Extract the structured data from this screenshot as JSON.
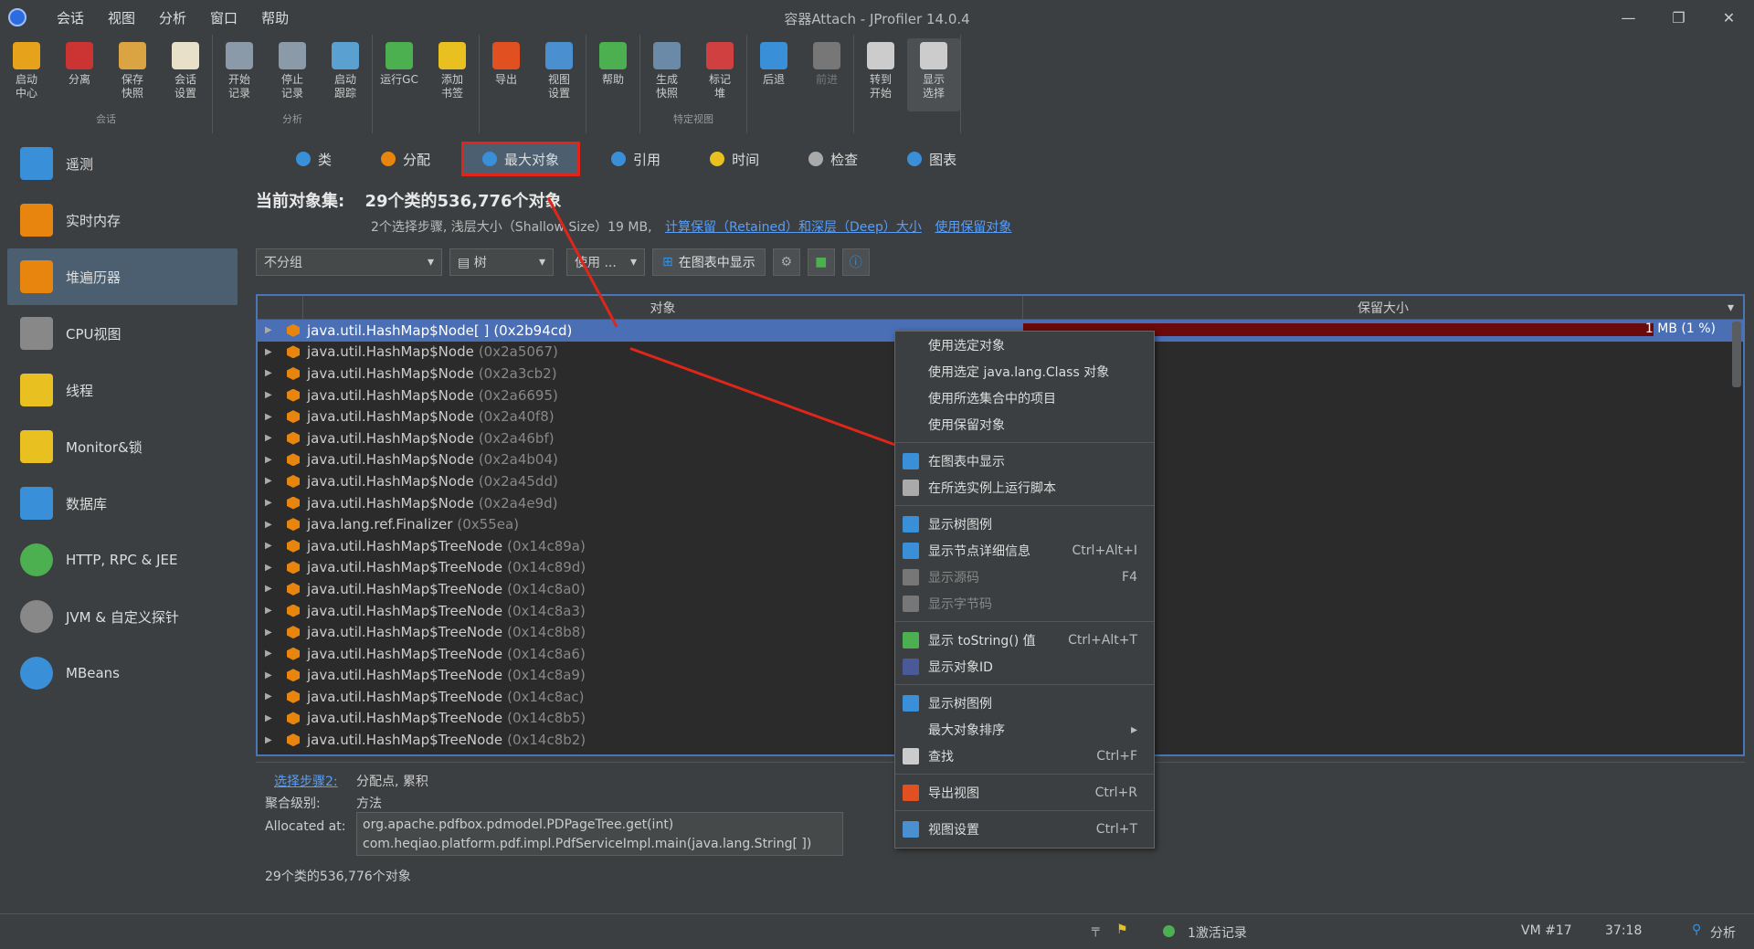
{
  "window": {
    "title": "容器Attach - JProfiler 14.0.4"
  },
  "menu": [
    "会话",
    "视图",
    "分析",
    "窗口",
    "帮助"
  ],
  "toolbar": {
    "groups": [
      {
        "label": "会话",
        "buttons": [
          {
            "label": "启动\n中心",
            "icon": "start-center-icon",
            "color": "#e6a21a"
          },
          {
            "label": "分离",
            "icon": "detach-icon",
            "color": "#cc3333"
          },
          {
            "label": "保存\n快照",
            "icon": "save-snapshot-icon",
            "color": "#d9a441"
          },
          {
            "label": "会话\n设置",
            "icon": "session-settings-icon",
            "color": "#e8e0c8"
          }
        ]
      },
      {
        "label": "分析",
        "buttons": [
          {
            "label": "开始\n记录",
            "icon": "start-recording-icon",
            "color": "#8a9aa8"
          },
          {
            "label": "停止\n记录",
            "icon": "stop-recording-icon",
            "color": "#8a9aa8"
          },
          {
            "label": "启动\n跟踪",
            "icon": "start-tracking-icon",
            "color": "#5aa0d0"
          }
        ]
      },
      {
        "label": "",
        "buttons": [
          {
            "label": "运行GC",
            "icon": "run-gc-icon",
            "color": "#4caf50"
          },
          {
            "label": "添加\n书签",
            "icon": "add-bookmark-icon",
            "color": "#e8c020"
          }
        ]
      },
      {
        "label": "",
        "buttons": [
          {
            "label": "导出",
            "icon": "export-icon",
            "color": "#e05020"
          },
          {
            "label": "视图\n设置",
            "icon": "view-settings-icon",
            "color": "#4a90d0"
          }
        ]
      },
      {
        "label": "",
        "buttons": [
          {
            "label": "帮助",
            "icon": "help-icon",
            "color": "#4caf50"
          }
        ]
      },
      {
        "label": "特定视图",
        "buttons": [
          {
            "label": "生成\n快照",
            "icon": "heap-snapshot-icon",
            "color": "#6a8aa8"
          },
          {
            "label": "标记\n堆",
            "icon": "mark-heap-icon",
            "color": "#d04040"
          }
        ]
      },
      {
        "label": "",
        "buttons": [
          {
            "label": "后退",
            "icon": "back-icon",
            "color": "#3a8fd9"
          },
          {
            "label": "前进",
            "icon": "forward-icon",
            "color": "#777777"
          }
        ]
      },
      {
        "label": "",
        "buttons": [
          {
            "label": "转到\n开始",
            "icon": "go-to-start-icon",
            "color": "#cccccc"
          },
          {
            "label": "显示\n选择",
            "icon": "show-selection-icon",
            "color": "#cccccc"
          }
        ]
      }
    ]
  },
  "sidebar": {
    "items": [
      {
        "label": "遥测",
        "icon": "telemetry-icon",
        "color": "#3a8fd9"
      },
      {
        "label": "实时内存",
        "icon": "live-memory-icon",
        "color": "#e8850f"
      },
      {
        "label": "堆遍历器",
        "icon": "heap-walker-icon",
        "color": "#e8850f"
      },
      {
        "label": "CPU视图",
        "icon": "cpu-views-icon",
        "color": "#888888"
      },
      {
        "label": "线程",
        "icon": "threads-icon",
        "color": "#e8c020"
      },
      {
        "label": "Monitor&锁",
        "icon": "monitor-lock-icon",
        "color": "#e8c020"
      },
      {
        "label": "数据库",
        "icon": "database-icon",
        "color": "#3a8fd9"
      },
      {
        "label": "HTTP, RPC & JEE",
        "icon": "globe-icon",
        "color": "#4caf50"
      },
      {
        "label": "JVM & 自定义探针",
        "icon": "probe-icon",
        "color": "#888888"
      },
      {
        "label": "MBeans",
        "icon": "mbeans-icon",
        "color": "#3a8fd9"
      }
    ]
  },
  "tabs": [
    {
      "label": "类",
      "icon": "class-icon",
      "color": "#3a8fd9"
    },
    {
      "label": "分配",
      "icon": "allocation-icon",
      "color": "#e8850f"
    },
    {
      "label": "最大对象",
      "icon": "biggest-objects-icon",
      "color": "#3a8fd9"
    },
    {
      "label": "引用",
      "icon": "references-icon",
      "color": "#3a8fd9"
    },
    {
      "label": "时间",
      "icon": "time-icon",
      "color": "#e8c020"
    },
    {
      "label": "检查",
      "icon": "inspections-icon",
      "color": "#aaaaaa"
    },
    {
      "label": "图表",
      "icon": "graph-icon",
      "color": "#3a8fd9"
    }
  ],
  "objectset": {
    "title": "当前对象集:",
    "summary": "29个类的536,776个对象",
    "details": "2个选择步骤, 浅层大小（Shallow Size）19 MB,",
    "link_compute": "计算保留（Retained）和深层（Deep）大小",
    "link_retained": "使用保留对象"
  },
  "controls": {
    "grouping": "不分组",
    "view_mode": "树",
    "use": "使用 ...",
    "show_graph": "在图表中显示"
  },
  "table": {
    "columns": [
      "对象",
      "保留大小"
    ],
    "retained_first": "1 MB (1 %)",
    "retained_fraction": 0.01,
    "rows": [
      {
        "cls": "java.util.HashMap$Node[ ]",
        "addr": "(0x2b94cd)"
      },
      {
        "cls": "java.util.HashMap$Node",
        "addr": "(0x2a5067)"
      },
      {
        "cls": "java.util.HashMap$Node",
        "addr": "(0x2a3cb2)"
      },
      {
        "cls": "java.util.HashMap$Node",
        "addr": "(0x2a6695)"
      },
      {
        "cls": "java.util.HashMap$Node",
        "addr": "(0x2a40f8)"
      },
      {
        "cls": "java.util.HashMap$Node",
        "addr": "(0x2a46bf)"
      },
      {
        "cls": "java.util.HashMap$Node",
        "addr": "(0x2a4b04)"
      },
      {
        "cls": "java.util.HashMap$Node",
        "addr": "(0x2a45dd)"
      },
      {
        "cls": "java.util.HashMap$Node",
        "addr": "(0x2a4e9d)"
      },
      {
        "cls": "java.lang.ref.Finalizer",
        "addr": "(0x55ea)"
      },
      {
        "cls": "java.util.HashMap$TreeNode",
        "addr": "(0x14c89a)"
      },
      {
        "cls": "java.util.HashMap$TreeNode",
        "addr": "(0x14c89d)"
      },
      {
        "cls": "java.util.HashMap$TreeNode",
        "addr": "(0x14c8a0)"
      },
      {
        "cls": "java.util.HashMap$TreeNode",
        "addr": "(0x14c8a3)"
      },
      {
        "cls": "java.util.HashMap$TreeNode",
        "addr": "(0x14c8b8)"
      },
      {
        "cls": "java.util.HashMap$TreeNode",
        "addr": "(0x14c8a6)"
      },
      {
        "cls": "java.util.HashMap$TreeNode",
        "addr": "(0x14c8a9)"
      },
      {
        "cls": "java.util.HashMap$TreeNode",
        "addr": "(0x14c8ac)"
      },
      {
        "cls": "java.util.HashMap$TreeNode",
        "addr": "(0x14c8b5)"
      },
      {
        "cls": "java.util.HashMap$TreeNode",
        "addr": "(0x14c8b2)"
      }
    ]
  },
  "detail": {
    "step_link": "选择步骤2:",
    "step_value": "分配点, 累积",
    "agg_label": "聚合级别:",
    "agg_value": "方法",
    "alloc_label": "Allocated at:",
    "alloc_lines": [
      "org.apache.pdfbox.pdmodel.PDPageTree.get(int)",
      "com.heqiao.platform.pdf.impl.PdfServiceImpl.main(java.lang.String[ ])"
    ],
    "footer": "29个类的536,776个对象"
  },
  "context_menu": {
    "groups": [
      [
        {
          "label": "使用选定对象"
        },
        {
          "label": "使用选定 java.lang.Class 对象"
        },
        {
          "label": "使用所选集合中的项目"
        },
        {
          "label": "使用保留对象"
        }
      ],
      [
        {
          "label": "在图表中显示",
          "icon": "graph-icon",
          "color": "#3a8fd9"
        },
        {
          "label": "在所选实例上运行脚本",
          "icon": "gear-icon",
          "color": "#aaaaaa"
        }
      ],
      [
        {
          "label": "显示树图例",
          "icon": "info-icon",
          "color": "#3a8fd9"
        },
        {
          "label": "显示节点详细信息",
          "icon": "node-details-icon",
          "color": "#3a8fd9",
          "shortcut": "Ctrl+Alt+I"
        },
        {
          "label": "显示源码",
          "icon": "source-icon",
          "color": "#777777",
          "shortcut": "F4",
          "disabled": true
        },
        {
          "label": "显示字节码",
          "icon": "bytecode-icon",
          "color": "#777777",
          "disabled": true
        }
      ],
      [
        {
          "label": "显示 toString() 值",
          "icon": "tostring-icon",
          "color": "#4caf50",
          "shortcut": "Ctrl+Alt+T"
        },
        {
          "label": "显示对象ID",
          "icon": "object-id-icon",
          "color": "#4a5a99"
        }
      ],
      [
        {
          "label": "显示树图例",
          "icon": "info-icon",
          "color": "#3a8fd9"
        },
        {
          "label": "最大对象排序",
          "submenu": true
        },
        {
          "label": "查找",
          "icon": "search-icon",
          "color": "#cccccc",
          "shortcut": "Ctrl+F"
        }
      ],
      [
        {
          "label": "导出视图",
          "icon": "export-icon",
          "color": "#e05020",
          "shortcut": "Ctrl+R"
        }
      ],
      [
        {
          "label": "视图设置",
          "icon": "view-settings-icon",
          "color": "#4a90d0",
          "shortcut": "Ctrl+T"
        }
      ]
    ]
  },
  "status": {
    "records": "1激活记录",
    "vm": "VM #17",
    "time": "37:18",
    "analysis": "分析"
  }
}
